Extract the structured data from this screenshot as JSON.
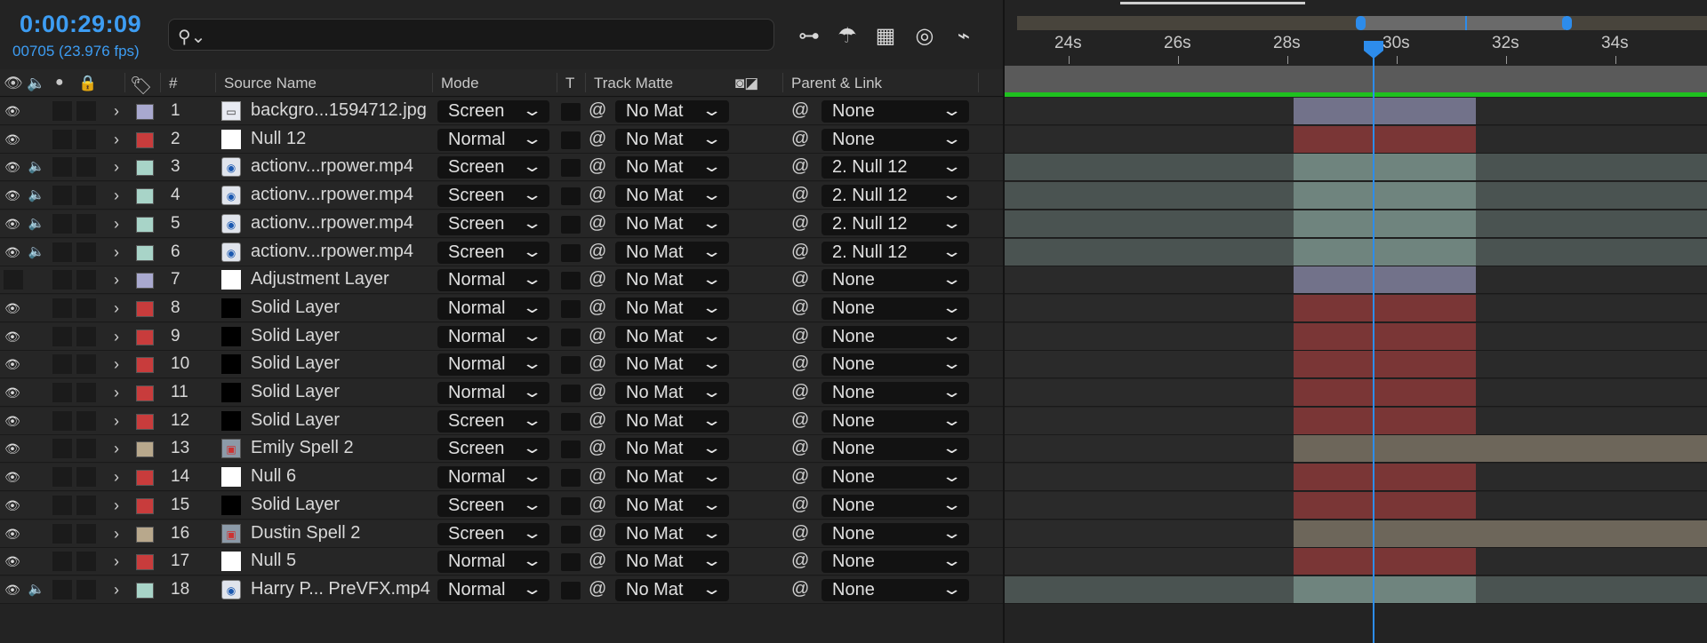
{
  "timecode": "0:00:29:09",
  "frameinfo": "00705 (23.976 fps)",
  "search": {
    "placeholder": ""
  },
  "toolbar": [
    "composition-flowchart-icon",
    "draft-3d-icon",
    "frame-blending-icon",
    "motion-blur-icon",
    "graph-editor-icon"
  ],
  "columns": {
    "num": "#",
    "source_name": "Source Name",
    "mode": "Mode",
    "t": "T",
    "track_matte": "Track Matte",
    "parent_link": "Parent & Link"
  },
  "layers": [
    {
      "num": "1",
      "name": "backgro...1594712.jpg",
      "mode": "Screen",
      "matte": "No Mat",
      "parent": "None",
      "label": "#a9a9cf",
      "bar": "#72728a",
      "type": "image",
      "eye": true,
      "audio": false
    },
    {
      "num": "2",
      "name": "Null 12",
      "mode": "Normal",
      "matte": "No Mat",
      "parent": "None",
      "label": "#c83c3c",
      "bar": "#7a3636",
      "type": "white",
      "eye": true,
      "audio": false
    },
    {
      "num": "3",
      "name": "actionv...rpower.mp4",
      "mode": "Screen",
      "matte": "No Mat",
      "parent": "2. Null 12",
      "label": "#a8d4c8",
      "bar": "#6f847e",
      "type": "video",
      "eye": true,
      "audio": true
    },
    {
      "num": "4",
      "name": "actionv...rpower.mp4",
      "mode": "Screen",
      "matte": "No Mat",
      "parent": "2. Null 12",
      "label": "#a8d4c8",
      "bar": "#6f847e",
      "type": "video",
      "eye": true,
      "audio": true
    },
    {
      "num": "5",
      "name": "actionv...rpower.mp4",
      "mode": "Screen",
      "matte": "No Mat",
      "parent": "2. Null 12",
      "label": "#a8d4c8",
      "bar": "#6f847e",
      "type": "video",
      "eye": true,
      "audio": true
    },
    {
      "num": "6",
      "name": "actionv...rpower.mp4",
      "mode": "Screen",
      "matte": "No Mat",
      "parent": "2. Null 12",
      "label": "#a8d4c8",
      "bar": "#6f847e",
      "type": "video",
      "eye": true,
      "audio": true
    },
    {
      "num": "7",
      "name": "Adjustment Layer",
      "mode": "Normal",
      "matte": "No Mat",
      "parent": "None",
      "label": "#a9a9cf",
      "bar": "#72728a",
      "type": "white",
      "eye": false,
      "audio": false
    },
    {
      "num": "8",
      "name": "Solid Layer",
      "mode": "Normal",
      "matte": "No Mat",
      "parent": "None",
      "label": "#c83c3c",
      "bar": "#7a3636",
      "type": "black",
      "eye": true,
      "audio": false
    },
    {
      "num": "9",
      "name": "Solid Layer",
      "mode": "Normal",
      "matte": "No Mat",
      "parent": "None",
      "label": "#c83c3c",
      "bar": "#7a3636",
      "type": "black",
      "eye": true,
      "audio": false
    },
    {
      "num": "10",
      "name": "Solid Layer",
      "mode": "Normal",
      "matte": "No Mat",
      "parent": "None",
      "label": "#c83c3c",
      "bar": "#7a3636",
      "type": "black",
      "eye": true,
      "audio": false
    },
    {
      "num": "11",
      "name": "Solid Layer",
      "mode": "Normal",
      "matte": "No Mat",
      "parent": "None",
      "label": "#c83c3c",
      "bar": "#7a3636",
      "type": "black",
      "eye": true,
      "audio": false
    },
    {
      "num": "12",
      "name": "Solid Layer",
      "mode": "Screen",
      "matte": "No Mat",
      "parent": "None",
      "label": "#c83c3c",
      "bar": "#7a3636",
      "type": "black",
      "eye": true,
      "audio": false
    },
    {
      "num": "13",
      "name": "Emily Spell 2",
      "mode": "Screen",
      "matte": "No Mat",
      "parent": "None",
      "label": "#b8a88c",
      "bar": "#6d665a",
      "type": "comp",
      "eye": true,
      "audio": false
    },
    {
      "num": "14",
      "name": "Null 6",
      "mode": "Normal",
      "matte": "No Mat",
      "parent": "None",
      "label": "#c83c3c",
      "bar": "#7a3636",
      "type": "white",
      "eye": true,
      "audio": false
    },
    {
      "num": "15",
      "name": "Solid Layer",
      "mode": "Screen",
      "matte": "No Mat",
      "parent": "None",
      "label": "#c83c3c",
      "bar": "#7a3636",
      "type": "black",
      "eye": true,
      "audio": false
    },
    {
      "num": "16",
      "name": "Dustin Spell 2",
      "mode": "Screen",
      "matte": "No Mat",
      "parent": "None",
      "label": "#b8a88c",
      "bar": "#6d665a",
      "type": "comp",
      "eye": true,
      "audio": false
    },
    {
      "num": "17",
      "name": "Null 5",
      "mode": "Normal",
      "matte": "No Mat",
      "parent": "None",
      "label": "#c83c3c",
      "bar": "#7a3636",
      "type": "white",
      "eye": true,
      "audio": false
    },
    {
      "num": "18",
      "name": "Harry P... PreVFX.mp4",
      "mode": "Normal",
      "matte": "No Mat",
      "parent": "None",
      "label": "#a8d4c8",
      "bar": "#6f847e",
      "type": "video",
      "eye": true,
      "audio": true
    }
  ],
  "ruler": [
    "24s",
    "26s",
    "28s",
    "30s",
    "32s",
    "34s"
  ],
  "colors": {
    "accent": "#2d8ceb",
    "work_area": "#1fc01f"
  }
}
